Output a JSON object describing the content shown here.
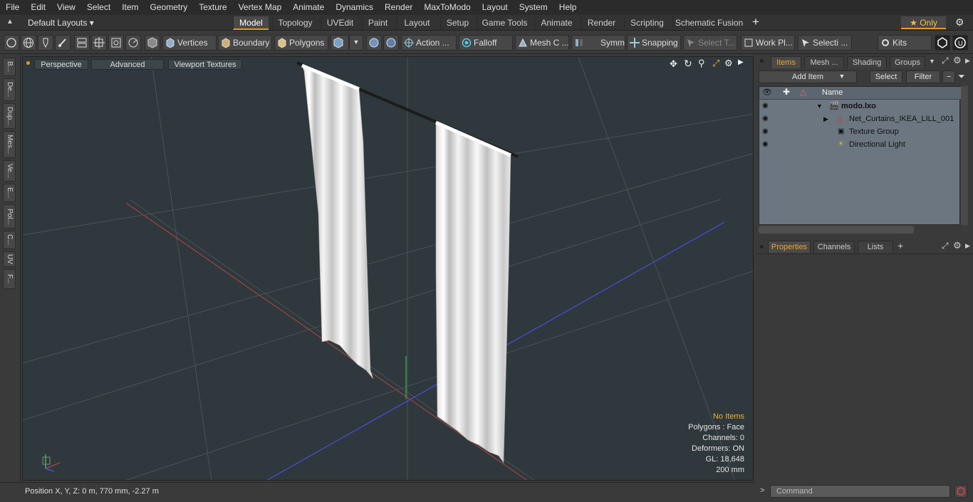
{
  "menu": [
    "File",
    "Edit",
    "View",
    "Select",
    "Item",
    "Geometry",
    "Texture",
    "Vertex Map",
    "Animate",
    "Dynamics",
    "Render",
    "MaxToModo",
    "Layout",
    "System",
    "Help"
  ],
  "layouts_label": "Default Layouts ▾",
  "tabs": [
    "Model",
    "Topology",
    "UVEdit",
    "Paint",
    "Layout",
    "Setup",
    "Game Tools",
    "Animate",
    "Render",
    "Scripting",
    "Schematic Fusion"
  ],
  "active_tab": "Model",
  "only_label": "★  Only",
  "toolbar": {
    "vertices": "Vertices",
    "boundary": "Boundary",
    "polygons": "Polygons",
    "action": "Action  ...",
    "falloff": "Falloff",
    "mesh": "Mesh C ...",
    "symm": "Symm ...",
    "snapping": "Snapping",
    "select_t": "Select T...",
    "work_pl": "Work Pl...",
    "selecti": "Selecti ...",
    "kits": "Kits"
  },
  "left_tabs": [
    "B...",
    "De...",
    "Dup...",
    "Mes...",
    "Ve...",
    "E...",
    "Pol...",
    "C...",
    "UV",
    "F..."
  ],
  "viewport": {
    "perspective": "Perspective",
    "advanced": "Advanced",
    "textures": "Viewport Textures",
    "stats": {
      "no_items": "No Items",
      "polygons": "Polygons : Face",
      "channels": "Channels: 0",
      "deformers": "Deformers: ON",
      "gl": "GL: 18,648",
      "scale": "200 mm"
    }
  },
  "status": {
    "position": "Position X, Y, Z:   0 m, 770 mm, -2.27 m"
  },
  "right_panel": {
    "tabs": [
      "Items",
      "Mesh ...",
      "Shading",
      "Groups"
    ],
    "add_item": "Add Item",
    "select": "Select",
    "filter": "Filter",
    "name_header": "Name",
    "items": [
      {
        "label": "modo.lxo"
      },
      {
        "label": "Net_Curtains_IKEA_LILL_001"
      },
      {
        "label": "Texture Group"
      },
      {
        "label": "Directional Light"
      }
    ],
    "prop_tabs": [
      "Properties",
      "Channels",
      "Lists"
    ],
    "command_placeholder": "Command"
  },
  "colors": {
    "accent": "#e09a2c",
    "viewport_bg": "#2f383c",
    "item_list_bg": "#6b7680"
  }
}
